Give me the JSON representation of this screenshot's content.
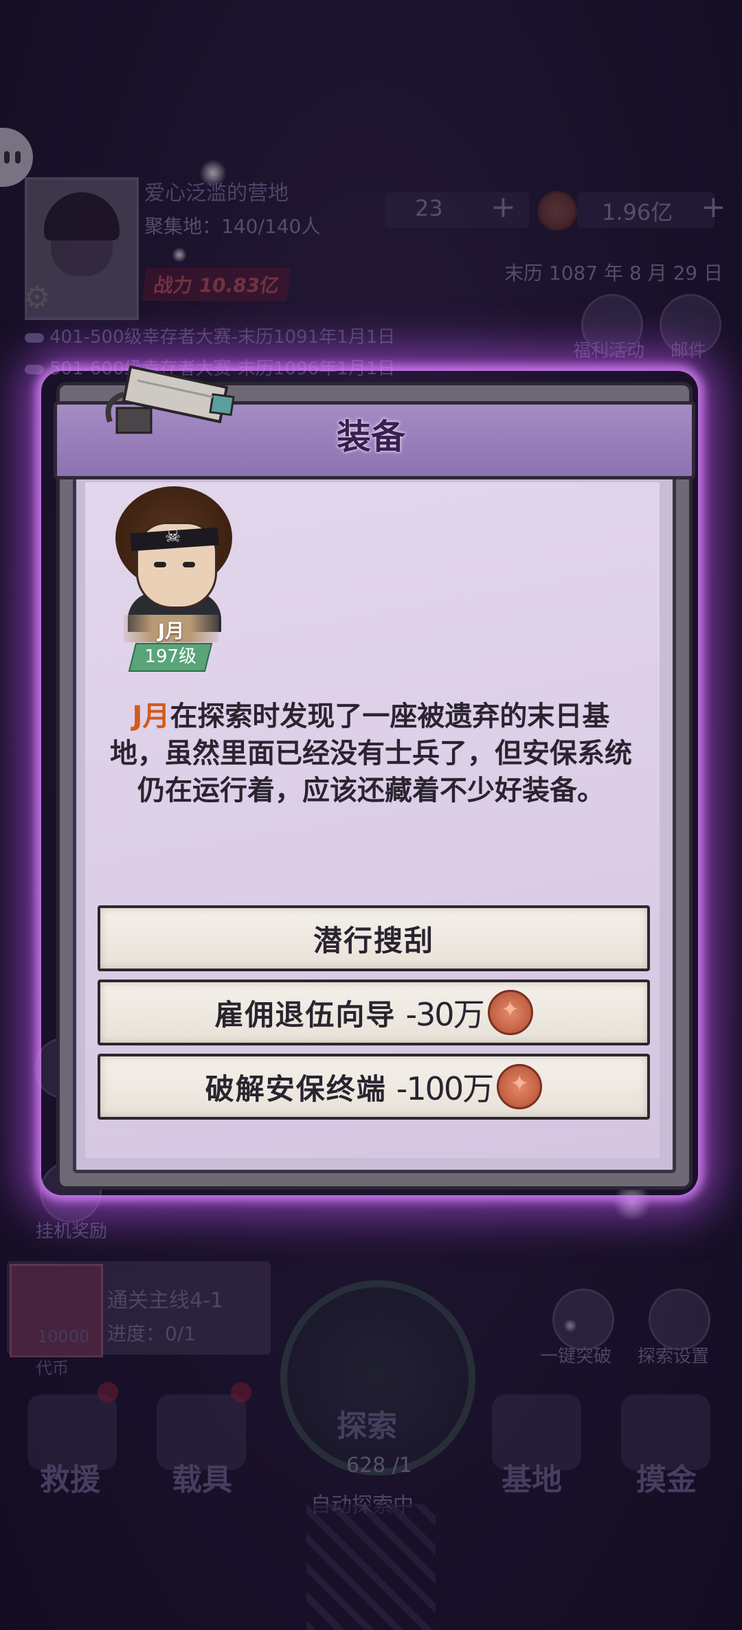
{
  "background": {
    "camp_name": "爱心泛滥的营地",
    "gather": "聚集地：140/140人",
    "power": "战力 10.83亿",
    "resource1": "23",
    "resource2": "1.96亿",
    "date": "末历 1087 年 8 月 29 日",
    "tickers": [
      "401-500级幸存者大赛-末历1091年1月1日",
      "501-600级幸存者大赛-末历1096年1月1日"
    ],
    "right_icons": [
      "福利活动",
      "邮件"
    ],
    "left_icons": [
      "挂机奖励"
    ],
    "mission": {
      "title": "通关主线4-1",
      "progress": "进度：0/1",
      "amount": "10000",
      "currency": "代币"
    },
    "quick_buttons": [
      "一键突破",
      "探索设置"
    ],
    "explore": {
      "label": "探索",
      "count": "628 /1",
      "auto": "自动探索中"
    },
    "nav": [
      "救援",
      "载具",
      "基地",
      "摸金"
    ]
  },
  "modal": {
    "title": "装备",
    "character": {
      "name": "J月",
      "level": "197级"
    },
    "story_highlight": "J月",
    "story_text": "在探索时发现了一座被遗弃的末日基地，虽然里面已经没有士兵了，但安保系统仍在运行着，应该还藏着不少好装备。",
    "choices": [
      {
        "label": "潜行搜刮",
        "cost": ""
      },
      {
        "label": "雇佣退伍向导",
        "cost": "-30万"
      },
      {
        "label": "破解安保终端",
        "cost": "-100万"
      }
    ]
  },
  "colors": {
    "glow": "#c85aff",
    "highlight": "#d35a1a",
    "header": "#9b82bd",
    "panel": "#ddd0e8"
  }
}
